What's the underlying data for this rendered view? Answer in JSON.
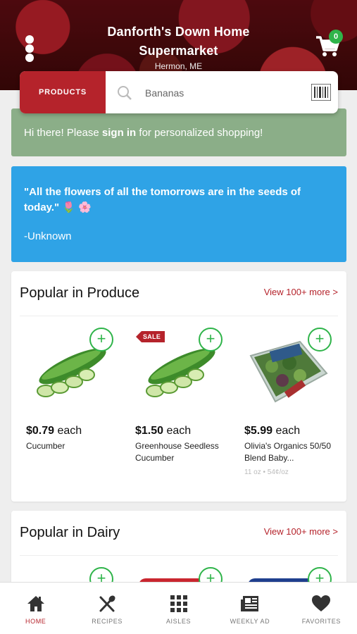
{
  "header": {
    "store_name": "Danforth's Down Home Supermarket",
    "location": "Hermon, ME",
    "cart_count": "0"
  },
  "search": {
    "products_label": "PRODUCTS",
    "placeholder": "Bananas"
  },
  "signin_banner": {
    "prefix": "Hi there! Please ",
    "link": "sign in",
    "suffix": " for personalized shopping!"
  },
  "quote": {
    "text": "\"All the flowers of all the tomorrows are in the seeds of today.\" 🌷 🌸",
    "author": "-Unknown"
  },
  "sections": [
    {
      "title": "Popular in Produce",
      "more": "View 100+ more >",
      "products": [
        {
          "price": "$0.79",
          "unit_label": "each",
          "name": "Cucumber",
          "sale": "",
          "unit_price": ""
        },
        {
          "price": "$1.50",
          "unit_label": "each",
          "name": "Greenhouse Seedless Cucumber",
          "sale": "SALE",
          "unit_price": ""
        },
        {
          "price": "$5.99",
          "unit_label": "each",
          "name": "Olivia's Organics 50/50 Blend Baby...",
          "sale": "",
          "unit_price": "11 oz • 54¢/oz"
        }
      ]
    },
    {
      "title": "Popular in Dairy",
      "more": "View 100+ more >"
    }
  ],
  "add_symbol": "+",
  "bottom_nav": [
    {
      "label": "HOME",
      "icon": "home-icon",
      "active": true
    },
    {
      "label": "RECIPES",
      "icon": "utensils-icon",
      "active": false
    },
    {
      "label": "AISLES",
      "icon": "grid-icon",
      "active": false
    },
    {
      "label": "WEEKLY AD",
      "icon": "newspaper-icon",
      "active": false
    },
    {
      "label": "FAVORITES",
      "icon": "heart-icon",
      "active": false
    }
  ],
  "colors": {
    "brand_red": "#b5232b",
    "add_green": "#2fb44a",
    "signin_green": "#8bae88",
    "quote_blue": "#2fa3e6"
  }
}
